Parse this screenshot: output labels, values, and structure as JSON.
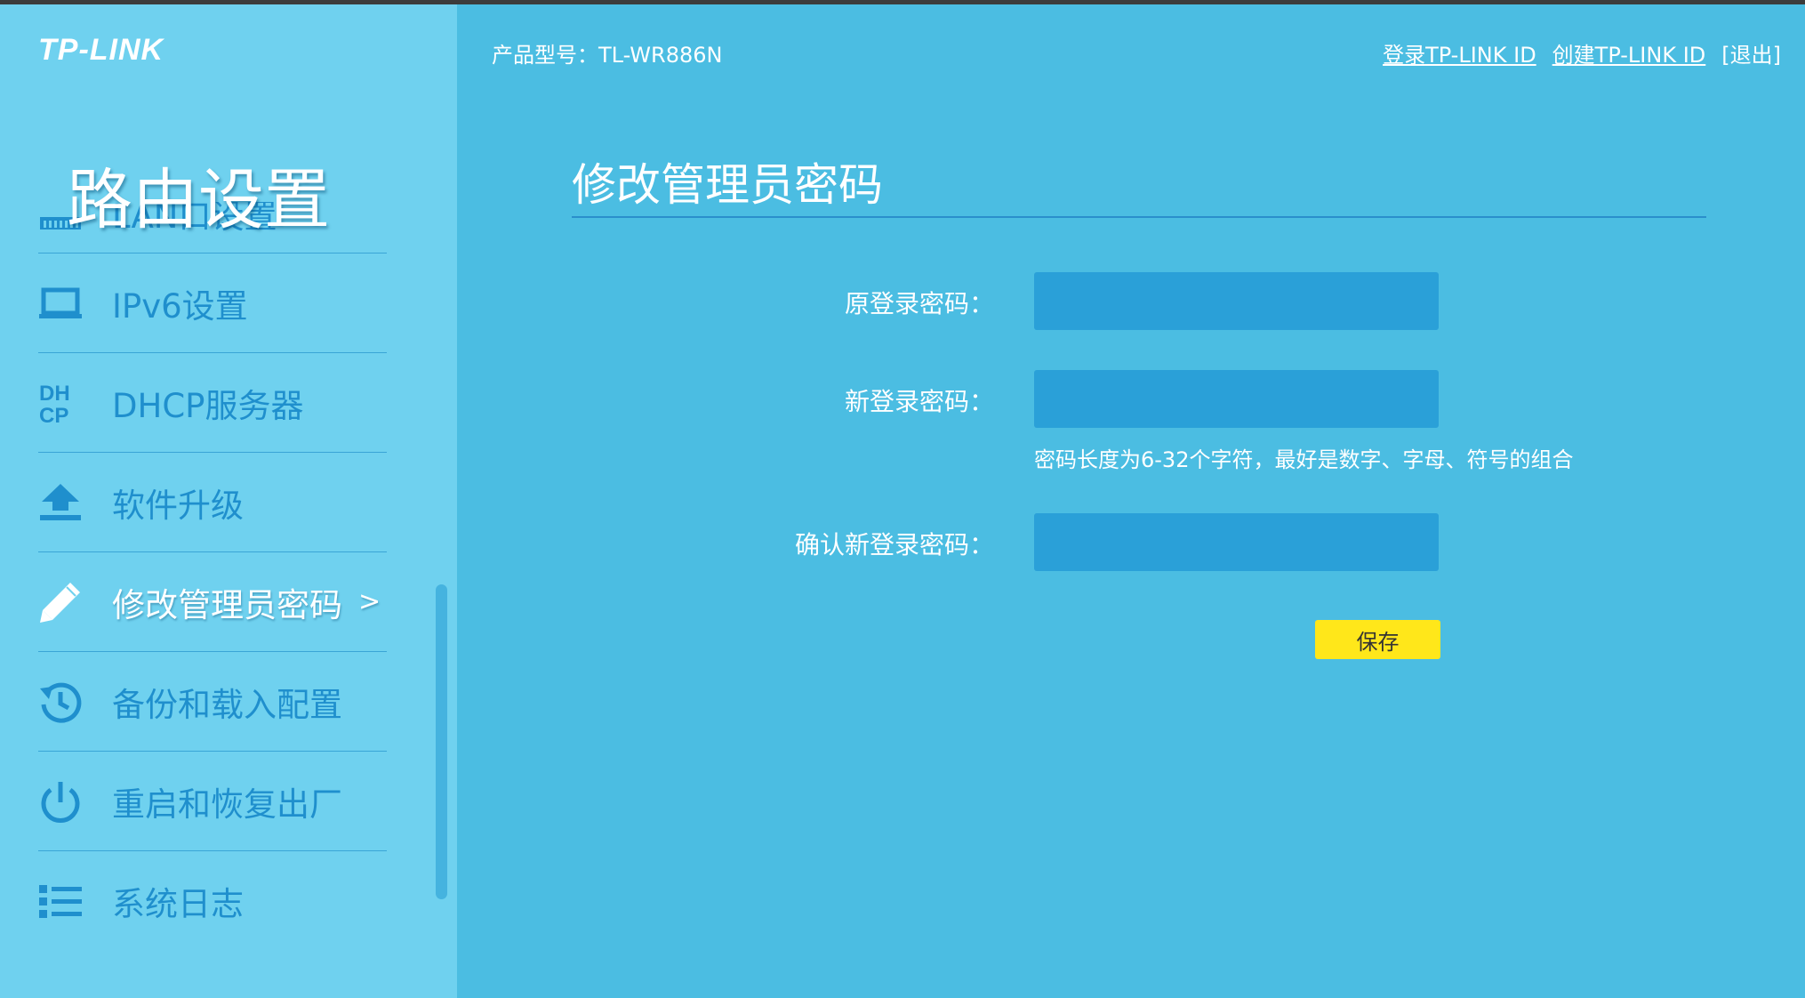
{
  "brand": {
    "logo_text": "TP-LINK"
  },
  "header": {
    "model_label": "产品型号：TL-WR886N",
    "login_link": "登录TP-LINK ID",
    "create_link": "创建TP-LINK ID",
    "logout_link": "[退出]"
  },
  "sidebar": {
    "section_title": "路由设置",
    "items": [
      {
        "label": "LAN口设置",
        "icon": "lan-port-icon",
        "active": false
      },
      {
        "label": "IPv6设置",
        "icon": "laptop-icon",
        "active": false
      },
      {
        "label": "DHCP服务器",
        "icon": "dhcp-icon",
        "active": false
      },
      {
        "label": "软件升级",
        "icon": "upload-icon",
        "active": false
      },
      {
        "label": "修改管理员密码",
        "icon": "pencil-icon",
        "active": true,
        "chevron": ">"
      },
      {
        "label": "备份和载入配置",
        "icon": "history-icon",
        "active": false
      },
      {
        "label": "重启和恢复出厂",
        "icon": "power-icon",
        "active": false
      },
      {
        "label": "系统日志",
        "icon": "list-icon",
        "active": false
      }
    ]
  },
  "content": {
    "title": "修改管理员密码",
    "form": {
      "old_password_label": "原登录密码：",
      "old_password_value": "",
      "new_password_label": "新登录密码：",
      "new_password_value": "",
      "password_hint": "密码长度为6-32个字符，最好是数字、字母、符号的组合",
      "confirm_password_label": "确认新登录密码：",
      "confirm_password_value": ""
    },
    "save_label": "保存"
  },
  "colors": {
    "sidebar_bg": "#6fd1ef",
    "main_bg": "#4bbde2",
    "menu_text": "#1f8fcd",
    "input_bg": "#2aa0d8",
    "save_button": "#ffe71a"
  }
}
